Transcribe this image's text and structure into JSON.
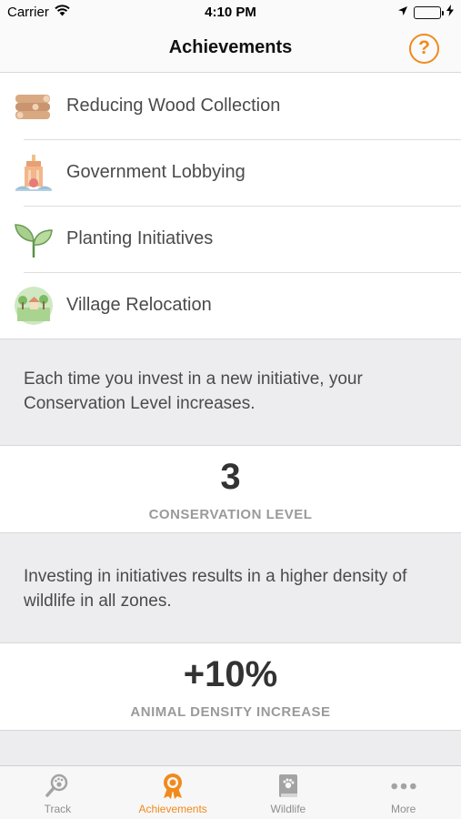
{
  "status_bar": {
    "carrier": "Carrier",
    "time": "4:10 PM"
  },
  "nav": {
    "title": "Achievements",
    "help_glyph": "?"
  },
  "initiatives": [
    {
      "label": "Reducing Wood Collection",
      "icon": "wood-logs-icon"
    },
    {
      "label": "Government Lobbying",
      "icon": "government-building-icon"
    },
    {
      "label": "Planting Initiatives",
      "icon": "seedling-icon"
    },
    {
      "label": "Village Relocation",
      "icon": "village-landscape-icon"
    }
  ],
  "conservation": {
    "info": "Each time you invest in a new initiative, your Conservation Level increases.",
    "value": "3",
    "label": "CONSERVATION LEVEL"
  },
  "density": {
    "info": "Investing in initiatives results in a higher density of wildlife in all zones.",
    "value": "+10%",
    "label": "ANIMAL DENSITY INCREASE"
  },
  "tabs": [
    {
      "label": "Track",
      "icon": "paw-magnifier-icon",
      "active": false
    },
    {
      "label": "Achievements",
      "icon": "award-ribbon-icon",
      "active": true
    },
    {
      "label": "Wildlife",
      "icon": "wildlife-book-icon",
      "active": false
    },
    {
      "label": "More",
      "icon": "more-dots-icon",
      "active": false
    }
  ],
  "colors": {
    "accent": "#f08a1c",
    "background": "#ededf0",
    "battery": "#4cd964"
  }
}
